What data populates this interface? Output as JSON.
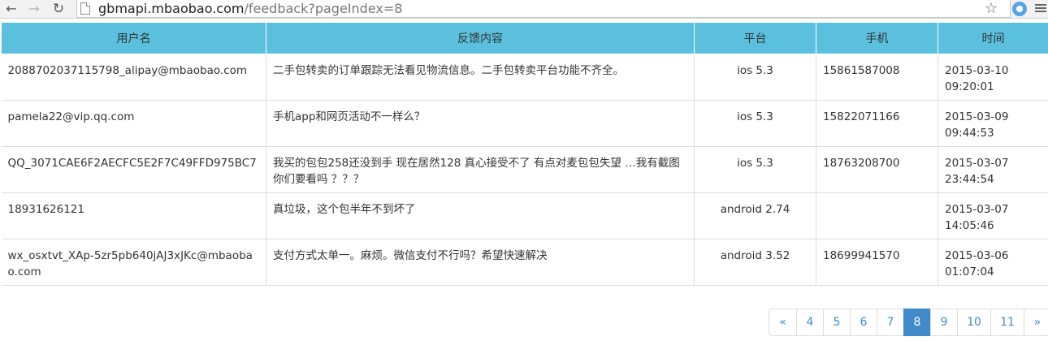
{
  "browser": {
    "url_host": "gbmapi.mbaobao.com",
    "url_path": "/feedback?pageIndex=8"
  },
  "table": {
    "headers": [
      "用户名",
      "反馈内容",
      "平台",
      "手机",
      "时间"
    ],
    "rows": [
      {
        "user": "2088702037115798_alipay@mbaobao.com",
        "content": "二手包转卖的订单跟踪无法看见物流信息。二手包转卖平台功能不齐全。",
        "platform": "ios 5.3",
        "phone": "15861587008",
        "date": "2015-03-10",
        "time": "09:20:01"
      },
      {
        "user": "pamela22@vip.qq.com",
        "content": "手机app和网页活动不一样么？",
        "platform": "ios 5.3",
        "phone": "15822071166",
        "date": "2015-03-09",
        "time": "09:44:53"
      },
      {
        "user": "QQ_3071CAE6F2AECFC5E2F7C49FFD975BC7",
        "content": "我买的包包258还没到手 现在居然128 真心接受不了 有点对麦包包失望 …我有截图 你们要看吗 ？？？",
        "platform": "ios 5.3",
        "phone": "18763208700",
        "date": "2015-03-07",
        "time": "23:44:54"
      },
      {
        "user": "18931626121",
        "content": "真垃圾，这个包半年不到坏了",
        "platform": "android 2.74",
        "phone": "",
        "date": "2015-03-07",
        "time": "14:05:46"
      },
      {
        "user": "wx_osxtvt_XAp-5zr5pb640jAJ3xJKc@mbaobao.com",
        "content": "支付方式太单一。麻烦。微信支付不行吗？希望快速解决",
        "platform": "android 3.52",
        "phone": "18699941570",
        "date": "2015-03-06",
        "time": "01:07:04"
      }
    ]
  },
  "pagination": {
    "prev": "«",
    "pages": [
      "4",
      "5",
      "6",
      "7",
      "8",
      "9",
      "10",
      "11"
    ],
    "active": "8",
    "next": "»"
  },
  "colors": {
    "header_bg": "#5bc0de",
    "link": "#428bca",
    "active_page_bg": "#428bca"
  }
}
